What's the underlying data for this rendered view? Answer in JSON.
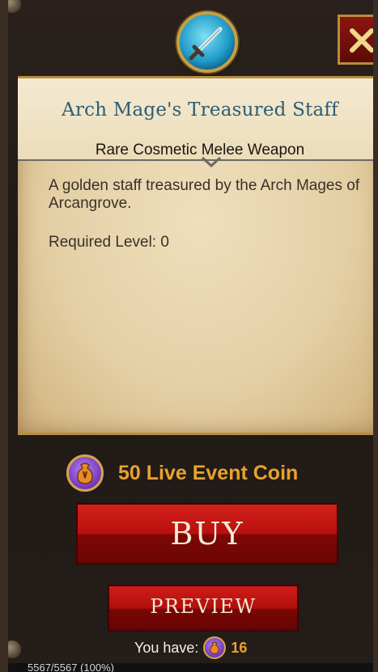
{
  "item": {
    "name": "Arch Mage's Treasured Staff",
    "type": "Rare Cosmetic Melee Weapon",
    "description": "A golden staff treasured by the Arch Mages of Arcangrove.",
    "required_level": "Required Level: 0",
    "icon": "sword-icon"
  },
  "purchase": {
    "price_text": "50 Live Event Coin",
    "currency_icon": "coin-bag-icon",
    "buy_label": "BUY",
    "preview_label": "PREVIEW",
    "you_have_label": "You have:",
    "owned_amount": "16"
  },
  "close_icon": "close-icon",
  "hp_readout": "5567/5567 (100%)",
  "colors": {
    "title": "#2d5c73",
    "price": "#e9a22c",
    "button_red": "#b8100d",
    "parchment": "#e5d0a6"
  }
}
